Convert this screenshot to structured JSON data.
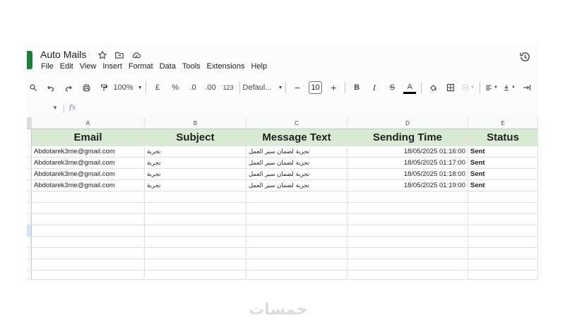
{
  "doc": {
    "title": "Auto Mails"
  },
  "menu": [
    "File",
    "Edit",
    "View",
    "Insert",
    "Format",
    "Data",
    "Tools",
    "Extensions",
    "Help"
  ],
  "toolbar": {
    "zoom": "100%",
    "currency": "£",
    "percent": "%",
    "dec_decrease": ".0",
    "dec_increase": ".00",
    "num_format": "123",
    "font": "Defaul...",
    "font_size": "10"
  },
  "formula": {
    "fx": "fx"
  },
  "columns": [
    "A",
    "B",
    "C",
    "D",
    "E"
  ],
  "headers": {
    "email": "Email",
    "subject": "Subject",
    "message": "Message Text",
    "time": "Sending Time",
    "status": "Status"
  },
  "rows": [
    {
      "email": "Abdotarek3me@gmail.com",
      "subject": "تجربة",
      "message": "تجربة لضمان سير العمل",
      "time": "18/05/2025 01:16:00",
      "status": "Sent"
    },
    {
      "email": "Abdotarek3me@gmail.com",
      "subject": "تجربة",
      "message": "تجربة لضمان سير العمل",
      "time": "18/05/2025 01:17:00",
      "status": "Sent"
    },
    {
      "email": "Abdotarek3me@gmail.com",
      "subject": "تجربة",
      "message": "تجربة لضمان سير العمل",
      "time": "18/05/2025 01:18:00",
      "status": "Sent"
    },
    {
      "email": "Abdotarek3me@gmail.com",
      "subject": "تجربة",
      "message": "تجربة لضمان سير العمل",
      "time": "18/05/2025 01:19:00",
      "status": "Sent"
    }
  ],
  "watermark": "خمسات",
  "colors": {
    "header_fill": "#d9ead3",
    "sheets_green": "#188038",
    "selected_row": "#d3e3fd"
  }
}
